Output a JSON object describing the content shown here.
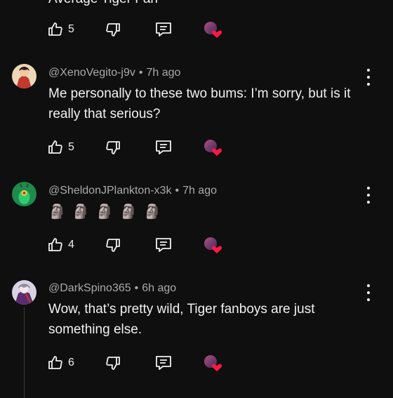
{
  "top_partial": {
    "text": "Average Tiger Fan",
    "like_count": "5"
  },
  "comments": [
    {
      "handle": "@XenoVegito-j9v",
      "time": "7h ago",
      "body": "Me personally to these two bums: I’m sorry, but is it really that serious?",
      "like_count": "5",
      "avatar_icon": "anime-character-avatar"
    },
    {
      "handle": "@SheldonJPlankton-x3k",
      "time": "7h ago",
      "body_emoji": [
        "🗿",
        "🗿",
        "🗿",
        "🗿",
        "🗿"
      ],
      "like_count": "4",
      "avatar_icon": "plankton-avatar"
    },
    {
      "handle": "@DarkSpino365",
      "time": "6h ago",
      "body": "Wow, that’s pretty wild, Tiger fanboys are just something else.",
      "like_count": "6",
      "avatar_icon": "dark-character-avatar"
    }
  ],
  "separator": "•",
  "icons": {
    "like": "thumbs-up-icon",
    "dislike": "thumbs-down-icon",
    "reply": "reply-bubble-icon",
    "creator_heart": "creator-heart-icon",
    "more": "more-vertical-icon"
  },
  "colors": {
    "background": "#0f0f0f",
    "text": "#f1f1f1",
    "meta": "#aaaaaa",
    "heart": "#ff1744"
  }
}
